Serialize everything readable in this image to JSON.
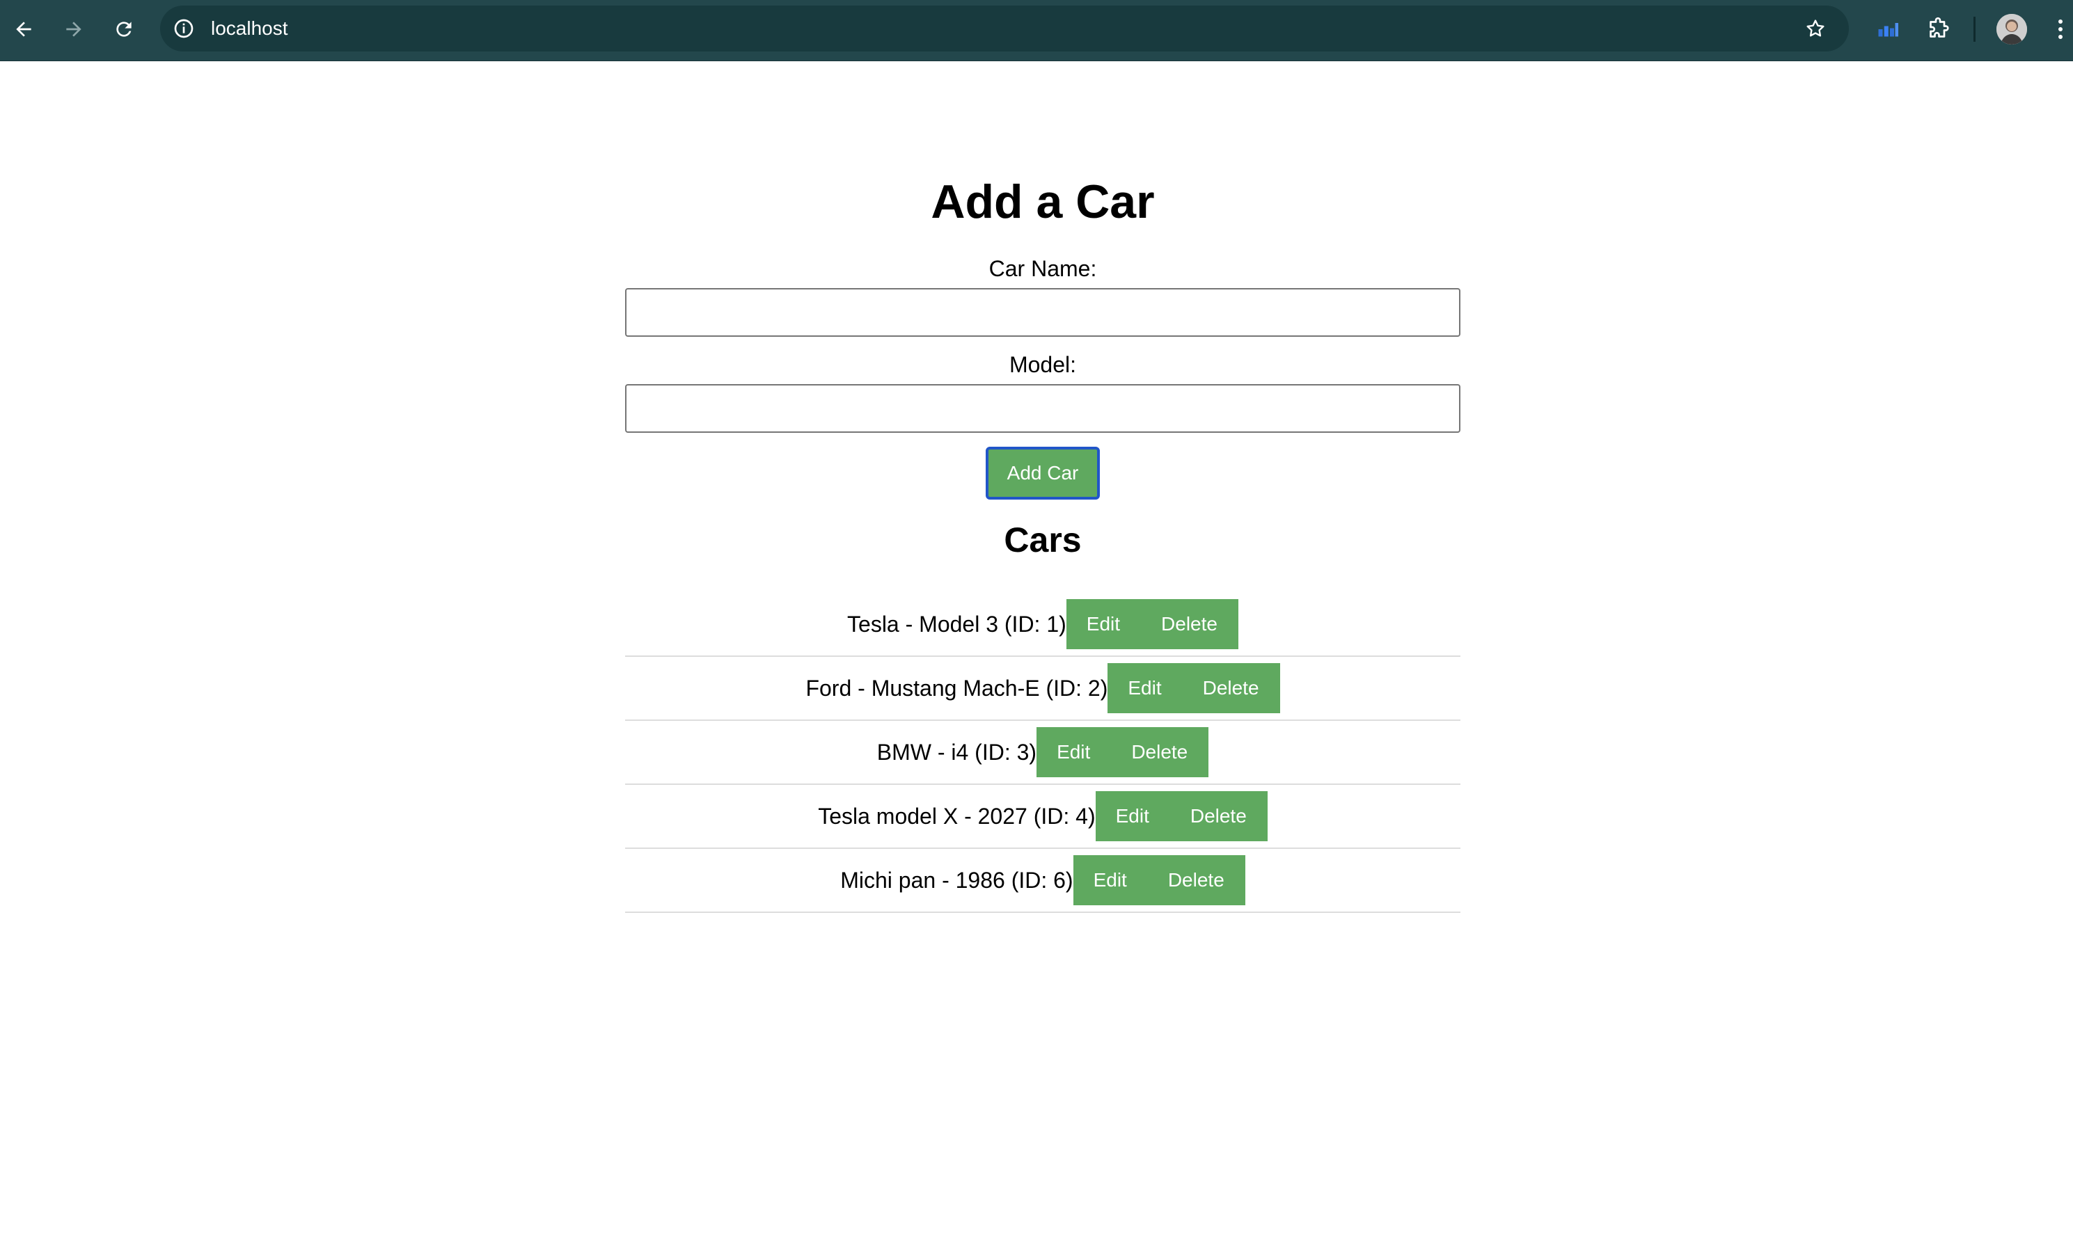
{
  "browser": {
    "url": "localhost"
  },
  "form": {
    "title": "Add a Car",
    "name_label": "Car Name:",
    "name_value": "",
    "model_label": "Model:",
    "model_value": "",
    "submit_label": "Add Car"
  },
  "list": {
    "title": "Cars",
    "items": [
      {
        "text": "Tesla - Model 3 (ID: 1)",
        "edit_label": "Edit",
        "delete_label": "Delete"
      },
      {
        "text": "Ford - Mustang Mach-E (ID: 2)",
        "edit_label": "Edit",
        "delete_label": "Delete"
      },
      {
        "text": "BMW - i4 (ID: 3)",
        "edit_label": "Edit",
        "delete_label": "Delete"
      },
      {
        "text": "Tesla model X - 2027 (ID: 4)",
        "edit_label": "Edit",
        "delete_label": "Delete"
      },
      {
        "text": "Michi pan - 1986 (ID: 6)",
        "edit_label": "Edit",
        "delete_label": "Delete"
      }
    ]
  },
  "colors": {
    "toolbar": "#23474c",
    "omnibox": "#183a3e",
    "button_green": "#5fa95f",
    "focus_ring": "#2156c8"
  },
  "icons": [
    "back-arrow-icon",
    "forward-arrow-icon",
    "reload-icon",
    "info-icon",
    "star-icon",
    "extension-chart-icon",
    "puzzle-icon",
    "avatar",
    "kebab-menu-icon"
  ]
}
